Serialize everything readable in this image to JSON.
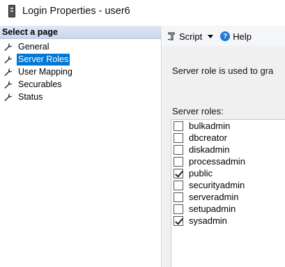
{
  "window": {
    "title": "Login Properties - user6"
  },
  "left_pane": {
    "header": "Select a page",
    "items": [
      {
        "label": "General",
        "selected": false
      },
      {
        "label": "Server Roles",
        "selected": true
      },
      {
        "label": "User Mapping",
        "selected": false
      },
      {
        "label": "Securables",
        "selected": false
      },
      {
        "label": "Status",
        "selected": false
      }
    ]
  },
  "toolbar": {
    "script_label": "Script",
    "help_label": "Help",
    "help_glyph": "?"
  },
  "main": {
    "description": "Server role is used to gra",
    "roles_label": "Server roles:",
    "roles": [
      {
        "name": "bulkadmin",
        "checked": false
      },
      {
        "name": "dbcreator",
        "checked": false
      },
      {
        "name": "diskadmin",
        "checked": false
      },
      {
        "name": "processadmin",
        "checked": false
      },
      {
        "name": "public",
        "checked": true
      },
      {
        "name": "securityadmin",
        "checked": false
      },
      {
        "name": "serveradmin",
        "checked": false
      },
      {
        "name": "setupadmin",
        "checked": false
      },
      {
        "name": "sysadmin",
        "checked": true
      }
    ]
  },
  "colors": {
    "selection": "#0078d7",
    "help_icon": "#1e7bd8",
    "header_bg": "#c9d7ec"
  }
}
